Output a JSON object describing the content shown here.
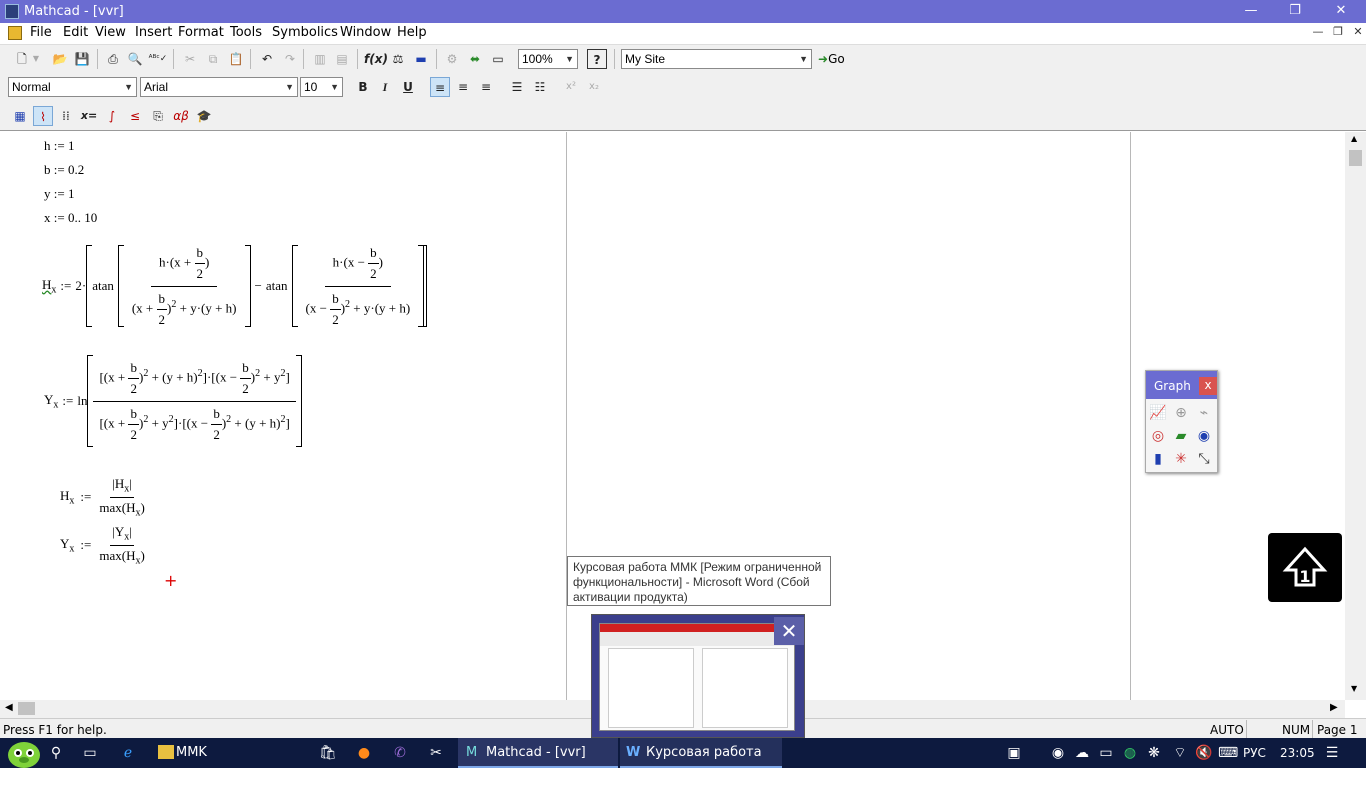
{
  "window": {
    "title": "Mathcad - [vvr]",
    "controls": {
      "minimize": "—",
      "restore": "❐",
      "close": "✕"
    }
  },
  "menu": {
    "items": [
      "File",
      "Edit",
      "View",
      "Insert",
      "Format",
      "Tools",
      "Symbolics",
      "Window",
      "Help"
    ]
  },
  "toolbar1": {
    "zoom": "100%",
    "site": "My Site",
    "go_label": "Go"
  },
  "toolbar2": {
    "style": "Normal",
    "font": "Arial",
    "size": "10",
    "bold": "B",
    "italic": "I",
    "underline": "U",
    "superscript": "x²",
    "subscript": "x₂"
  },
  "worksheet": {
    "defs": [
      {
        "var": "h",
        "op": ":=",
        "val": "1"
      },
      {
        "var": "b",
        "op": ":=",
        "val": "0.2"
      },
      {
        "var": "y",
        "op": ":=",
        "val": "1"
      },
      {
        "var": "x",
        "op": ":=",
        "val": "0.. 10"
      }
    ],
    "eq_H": {
      "lhs": "H",
      "sub": "x",
      "coef": "2",
      "fn": "atan",
      "minus": "−"
    },
    "eq_Y": {
      "lhs": "Y",
      "sub": "x",
      "fn": "ln"
    },
    "norm_H": {
      "lhs": "H",
      "sub": "x",
      "num": "H",
      "den_fn": "max",
      "den": "H"
    },
    "norm_Y": {
      "lhs": "Y",
      "sub": "x",
      "num": "Y",
      "den_fn": "max",
      "den": "H"
    },
    "cursor": "+"
  },
  "graph_palette": {
    "title": "Graph",
    "close": "x"
  },
  "tooltip": {
    "text": "Курсовая работа ММК [Режим ограниченной функциональности] - Microsoft Word (Сбой активации продукта)"
  },
  "thumbnail": {
    "close": "✕"
  },
  "statusbar": {
    "help": "Press F1 for help.",
    "auto": "AUTO",
    "num": "NUM",
    "page": "Page 1"
  },
  "taskbar": {
    "folder_label": "MMK",
    "mathcad_label": "Mathcad - [vvr]",
    "word_label": "Курсовая работа М...",
    "lang": "РУС",
    "time": "23:05"
  }
}
